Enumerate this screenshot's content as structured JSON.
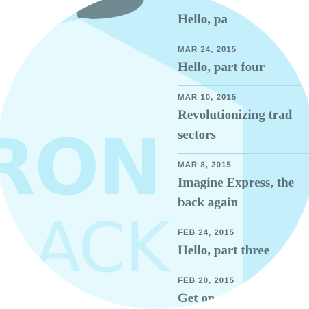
{
  "posts": [
    {
      "date": "",
      "title_lines": [
        "Hello, pa"
      ]
    },
    {
      "date": "MAR 24, 2015",
      "title_lines": [
        "Hello, part four"
      ]
    },
    {
      "date": "MAR 10, 2015",
      "title_lines": [
        "Revolutionizing trad",
        "sectors"
      ]
    },
    {
      "date": "MAR 8, 2015",
      "title_lines": [
        "Imagine Express, the",
        "back again"
      ]
    },
    {
      "date": "FEB 24, 2015",
      "title_lines": [
        "Hello, part three"
      ]
    },
    {
      "date": "FEB 20, 2015",
      "title_lines": [
        "Get on"
      ]
    }
  ],
  "background_words": [
    "RON",
    "ACK"
  ],
  "colors": {
    "circle_bg": "#c5f0fb",
    "panel_light": "#e6fafe",
    "text": "#5b7177",
    "divider": "#a6dce9",
    "top_shape": "#6f8a90"
  }
}
